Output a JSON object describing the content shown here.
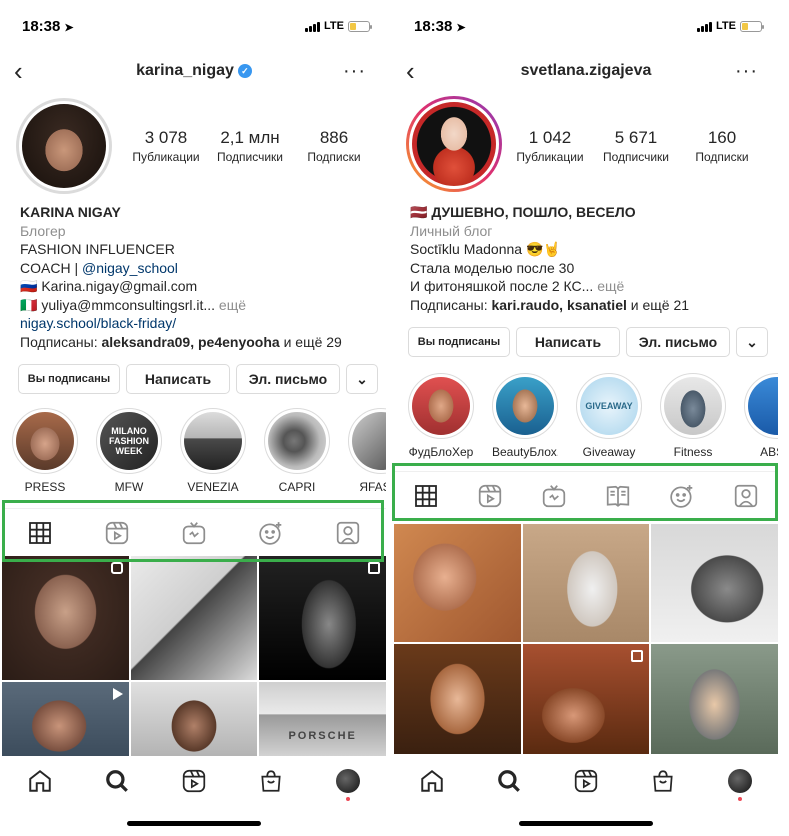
{
  "accent_green": "#3aae4b",
  "link_color": "#00376b",
  "left_phone": {
    "status": {
      "time": "18:38",
      "network": "LTE"
    },
    "header": {
      "username": "karina_nigay",
      "verified": true,
      "more_label": "···"
    },
    "stats": [
      {
        "num": "3 078",
        "label": "Публикации"
      },
      {
        "num": "2,1 млн",
        "label": "Подписчики"
      },
      {
        "num": "886",
        "label": "Подписки"
      }
    ],
    "bio": {
      "name": "KARINA NIGAY",
      "category": "Блогер",
      "line1": "FASHION INFLUENCER",
      "line2_prefix": "COACH | ",
      "line2_link": "@nigay_school",
      "email1": "🇷🇺 Karina.nigay@gmail.com",
      "email2": "🇮🇹 yuliya@mmconsultingsrl.it...",
      "email2_more": " ещё",
      "website": "nigay.school/black-friday/",
      "followed_prefix": "Подписаны: ",
      "followed_names": "aleksandra09, pe4enyooha",
      "followed_suffix": " и ещё 29"
    },
    "buttons": {
      "following": "Вы подписаны",
      "message": "Написать",
      "email": "Эл. письмо",
      "dropdown": "⌄"
    },
    "highlights": [
      {
        "label": "PRESS",
        "icon": "press-highlight"
      },
      {
        "label": "MFW",
        "icon": "mfw-highlight",
        "cover_text": "MILANO FASHION WEEK"
      },
      {
        "label": "VENEZIA",
        "icon": "venezia-highlight"
      },
      {
        "label": "CAPRI",
        "icon": "capri-highlight"
      },
      {
        "label": "ЯFASHI",
        "icon": "fashion-highlight"
      }
    ],
    "tabs": [
      "grid-icon",
      "reels-icon",
      "igtv-icon",
      "tagged-effects-icon",
      "tagged-icon"
    ],
    "grid_cell_text": "PORSCHE"
  },
  "right_phone": {
    "status": {
      "time": "18:38",
      "network": "LTE"
    },
    "header": {
      "username": "svetlana.zigajeva",
      "verified": false,
      "more_label": "···"
    },
    "stats": [
      {
        "num": "1 042",
        "label": "Публикации"
      },
      {
        "num": "5 671",
        "label": "Подписчики"
      },
      {
        "num": "160",
        "label": "Подписки"
      }
    ],
    "bio": {
      "name": "🇱🇻 ДУШЕВНО, ПОШЛО, ВЕСЕЛО",
      "category": "Личный блог",
      "line1": "Soctīklu Madonna 😎🤘",
      "line2": "Стала моделью после 30",
      "line3": "И фитоняшкой после 2 КС...",
      "line3_more": " ещё",
      "followed_prefix": "Подписаны: ",
      "followed_names": "kari.raudo, ksanatiel",
      "followed_suffix": " и ещё 21"
    },
    "buttons": {
      "following": "Вы подписаны",
      "message": "Написать",
      "email": "Эл. письмо",
      "dropdown": "⌄"
    },
    "highlights": [
      {
        "label": "ФудБлоХер",
        "icon": "foodblog-highlight"
      },
      {
        "label": "BeautyБлох...",
        "icon": "beauty-highlight"
      },
      {
        "label": "Giveaway",
        "icon": "giveaway-highlight",
        "cover_text": "GIVEAWAY"
      },
      {
        "label": "Fitness",
        "icon": "fitness-highlight"
      },
      {
        "label": "ABS Г",
        "icon": "abs-highlight"
      }
    ],
    "tabs": [
      "grid-icon",
      "reels-icon",
      "igtv-icon",
      "guides-icon",
      "tagged-effects-icon",
      "tagged-icon"
    ]
  },
  "bottom_nav": [
    "home-icon",
    "search-icon",
    "reels-icon",
    "shop-icon",
    "profile-avatar"
  ]
}
